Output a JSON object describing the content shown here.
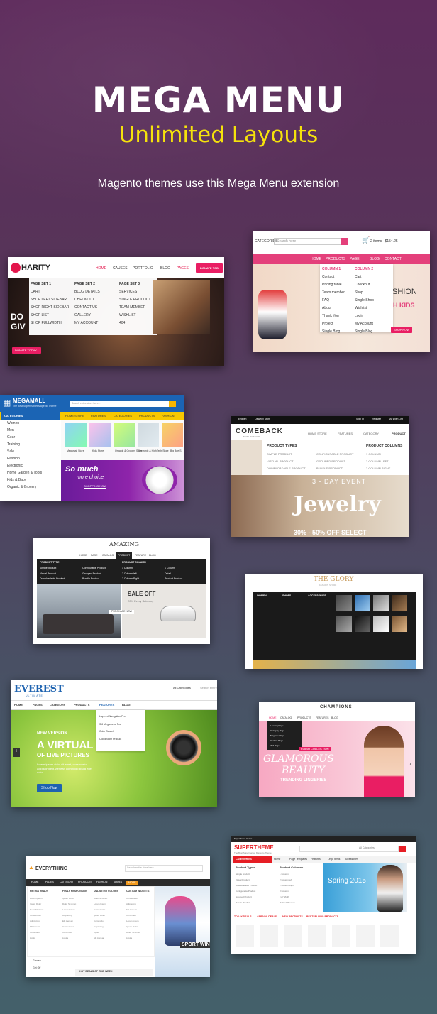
{
  "hero": {
    "title": "MEGA MENU",
    "subtitle": "Unlimited Layouts",
    "description": "Magento themes use this Mega Menu extension"
  },
  "charity": {
    "logo": "HARITY",
    "nav": [
      "HOME",
      "CAUSES",
      "PORTFOLIO",
      "BLOG",
      "PAGES"
    ],
    "donate": "DONATE TOD",
    "sets": [
      {
        "title": "PAGE SET 1",
        "items": [
          "CART",
          "SHOP LEFT SIDEBAR",
          "SHOP RIGHT SIDEBAR",
          "SHOP LIST",
          "SHOP FULLWIDTH"
        ]
      },
      {
        "title": "PAGE SET 2",
        "items": [
          "BLOG DETAILS",
          "CHECKOUT",
          "CONTACT US",
          "GALLERY",
          "MY ACCOUNT"
        ]
      },
      {
        "title": "PAGE SET 3",
        "items": [
          "SERVICES",
          "SINGLE PRODUCT",
          "TEAM MEMBER",
          "WISHLIST",
          "404"
        ]
      }
    ],
    "hero_text": [
      "DO",
      "GIV"
    ],
    "donate_button": "DONATE TODAY !"
  },
  "fashion": {
    "categories": "CATEGORIES",
    "search_placeholder": "Search here",
    "cart": "2 items - $154.25",
    "nav": [
      "HOME",
      "PRODUCTS",
      "PAGE",
      "BLOG",
      "CONTACT"
    ],
    "col1_title": "COLUMN 1",
    "col1": [
      "Contact",
      "Pricing table",
      "Team member",
      "FAQ",
      "About",
      "Thank You",
      "Project",
      "Single Blog"
    ],
    "col2_title": "COLUMN 2",
    "col2": [
      "Cart",
      "Checkout",
      "Shop",
      "Single Shop",
      "Wishlist",
      "Login",
      "My Account",
      "Single Blog"
    ],
    "banner": [
      "SHION",
      "H KIDS"
    ],
    "shop_now": "SHOP NOW"
  },
  "megamall": {
    "logo": "MEGAMALL",
    "tagline": "The Best Supermarket Magento Theme",
    "search_placeholder": "Search entire store here...",
    "categories_label": "CATEGORIES",
    "categories": [
      "Women",
      "Men",
      "Gear",
      "Training",
      "Sale",
      "Fashion",
      "Electronic",
      "Home Garden & Tools",
      "Kids & Baby",
      "Organic & Grocery"
    ],
    "nav": [
      "HOME STORE",
      "FEATURES",
      "CATEGORIES",
      "PRODUCTS",
      "FASHION"
    ],
    "stores": [
      "Megamall Store",
      "Kids Store",
      "Organic & Grocery Store",
      "Electronic & HighTech Store",
      "Big Bee S"
    ],
    "promo": [
      "So much",
      "more choice"
    ],
    "shop_now": "SHOPPING NOW"
  },
  "comeback": {
    "topbar": [
      "English",
      "Jewelry Store",
      "Sign In",
      "Register",
      "My Wish List"
    ],
    "logo": "COMEBACK",
    "logo_sub": "JEWELRY STORE",
    "nav": [
      "HOME STORE",
      "FEATURES",
      "CATEGORY",
      "PRODUCT"
    ],
    "types_title": "PRODUCT TYPES",
    "types_col1": [
      "SIMPLE PRODUCT",
      "VIRTUAL PRODUCT",
      "DOWNLOADABLE PRODUCT"
    ],
    "types_col2": [
      "CONFIGURABLE PRODUCT",
      "GROUPED PRODUCT",
      "BUNDLE PRODUCT"
    ],
    "columns_title": "PRODUCT COLUMNS",
    "columns": [
      "1 COLUMN",
      "2 COLUMN LEFT",
      "2 COLUMN RIGHT"
    ],
    "event": "3 - DAY EVENT",
    "headline": "Jewelry",
    "sale": "30% - 50% OFF SELECT"
  },
  "amazing": {
    "logo": "AMAZING",
    "nav": [
      "HOME",
      "PAGE",
      "CATALOG",
      "PRODUCT",
      "FEATURE",
      "BLOG"
    ],
    "product_types": "PRODUCT TYPE",
    "product_columns": "PRODUCT COLUMN",
    "items_a": [
      "Simple product",
      "Virtual Product",
      "Downloadable Product"
    ],
    "items_b": [
      "Configurable Product",
      "Grouped Product",
      "Bundle Product"
    ],
    "items_c": [
      "1 Column",
      "2 Column left",
      "2 Column Right"
    ],
    "items_d": [
      "1 Column",
      "Detail",
      "Product Product"
    ],
    "sale": "SALE OFF",
    "sale_sub": "20% Every Saturday",
    "purchase": "PURCHASE NOW"
  },
  "glory": {
    "logo": "THE GLORY",
    "logo_sub": "FASHION STORE",
    "cols": [
      "WOMEN",
      "SHOES",
      "ACCESSORIES"
    ]
  },
  "everest": {
    "logo": "EVEREST",
    "logo_sub": "ULTIMATE",
    "categories": "All Categories",
    "search_placeholder": "Search entire",
    "nav": [
      "HOME",
      "PAGES",
      "CATEGORY",
      "PRODUCTS",
      "FEATURES",
      "BLOG"
    ],
    "dropdown": [
      "Layered Navigation Pro",
      "SM Megamenu Pro",
      "Color Swatch",
      "CloudZoom Product"
    ],
    "new_version": "NEW VERSION",
    "headline": "A VIRTUAL",
    "headline2": "OF LIVE PICTURES",
    "body": "Lorem ipsum dolor sit amet, consectetur adipiscing elit. Aenean commodo ligula eget dolor.",
    "shop_now": "Shop Now"
  },
  "champions": {
    "logo": "CHAMPIONS",
    "nav": [
      "HOME",
      "CATALOG",
      "PRODUCTS",
      "FEATURES",
      "BLOG"
    ],
    "dropdown": [
      "Landing Page",
      "Category Page",
      "Magento Page",
      "Contact Page",
      "404 Page"
    ],
    "banner_top": "FLASH COLLECTION",
    "headline1": "GLAMOROUS",
    "headline2": "BEAUTY",
    "banner_sub": "TRENDING LINGERIES"
  },
  "everything": {
    "logo": "EVERYTHING",
    "search_placeholder": "Search entire store here...",
    "nav": [
      "HOME",
      "PAGES",
      "CATEGORY",
      "PRODUCTS",
      "FASHION",
      "SHOES",
      "MORE"
    ],
    "cols": [
      "RETINA READY",
      "FULLY RESPONSIVE",
      "UNLIMITED COLORS",
      "CUSTOM WIDGETS"
    ],
    "items": [
      "Lorem Ipsum",
      "Ipsum Dolor",
      "Dolor Sit Amet",
      "Consectetur",
      "Adipiscing",
      "Elit Aenean",
      "Commodo",
      "Ligula"
    ],
    "side": [
      "Garden",
      "Get Off"
    ],
    "hot": "HOT DEALS OF THIS WEEK",
    "sport": "SPORT WINT"
  },
  "supertheme": {
    "top": "Supertheme Outlet",
    "logo": "SUPERTHEME",
    "tagline": "The Best Supermarket Magento Theme",
    "search_placeholder": "All Categories",
    "nav": [
      "Home",
      "Page Templates",
      "Features",
      "Lego Items",
      "Accessories"
    ],
    "categories": "CATEGORIES",
    "product_types": "Product Types",
    "product_columns": "Product Columns",
    "types": [
      "Simple product",
      "Virtual Product",
      "Downloadable Product",
      "Configurable Product",
      "Grouped Product",
      "Bundle Product"
    ],
    "columns": [
      "1 Column",
      "2 Column left",
      "2 Column Right",
      "3 Column",
      "Full Width",
      "Related Product"
    ],
    "promo": "Spring 2015",
    "tabs": [
      "TODAY DEALS",
      "ARRIVAL DEALS",
      "NEW PRODUCTS",
      "BESTSELLING PRODUCTS"
    ]
  }
}
